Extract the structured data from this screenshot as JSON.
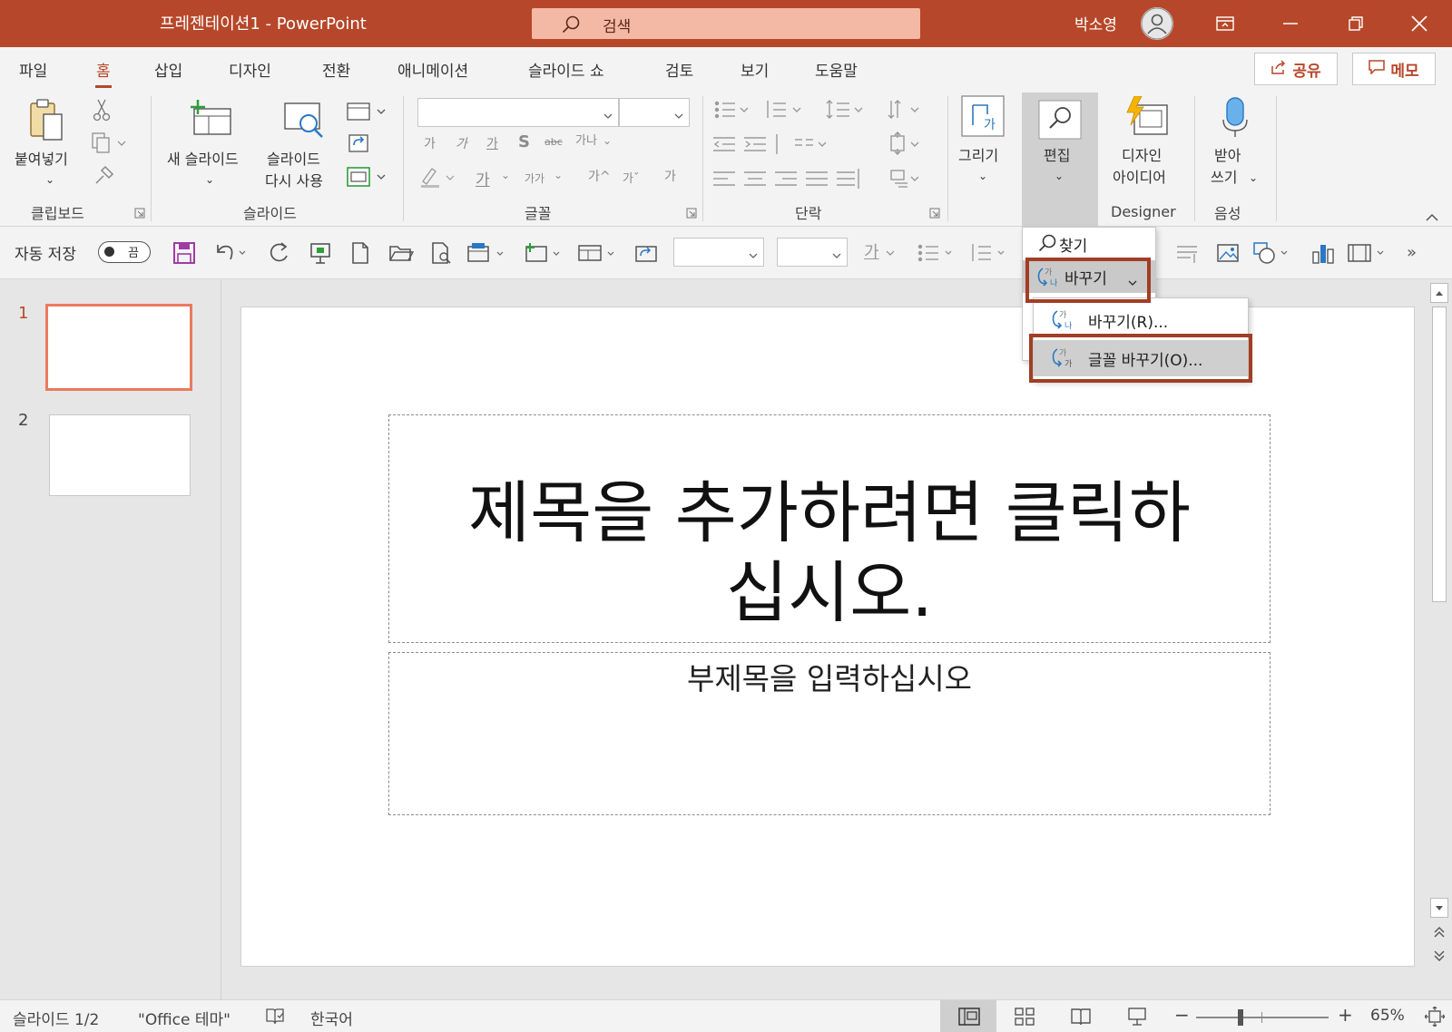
{
  "colors": {
    "accent": "#b7472a",
    "highlight": "#a13e25"
  },
  "titlebar": {
    "doc_title": "프레젠테이션1  -  PowerPoint",
    "search_placeholder": "검색",
    "user_name": "박소영"
  },
  "tabs": [
    "파일",
    "홈",
    "삽입",
    "디자인",
    "전환",
    "애니메이션",
    "슬라이드 쇼",
    "검토",
    "보기",
    "도움말"
  ],
  "active_tab": "홈",
  "share_label": "공유",
  "memo_label": "메모",
  "ribbon": {
    "paste": "붙여넣기",
    "new_slide": "새 슬라이드",
    "reuse_slide_1": "슬라이드",
    "reuse_slide_2": "다시 사용",
    "draw": "그리기",
    "edit": "편집",
    "design_ideas_1": "디자인",
    "design_ideas_2": "아이디어",
    "dictate_1": "받아",
    "dictate_2": "쓰기",
    "groups": {
      "clipboard": "클립보드",
      "slides": "슬라이드",
      "font": "글꼴",
      "paragraph": "단락",
      "designer": "Designer",
      "voice": "음성"
    },
    "font_row": {
      "g1": "가",
      "g2": "가",
      "g3": "가",
      "g4": "S",
      "g5": "가나",
      "g6": "가",
      "g7": "가가",
      "g8": "가^",
      "g9": "가ˇ",
      "g10": "가"
    }
  },
  "qat": {
    "autosave_label": "자동 저장",
    "toggle_state": "끔"
  },
  "edit_menu": {
    "find": "찾기",
    "replace": "바꾸기",
    "sub_icon_text": "가나",
    "submenu": [
      "바꾸기(R)...",
      "글꼴 바꾸기(O)..."
    ]
  },
  "thumbnails": [
    "1",
    "2"
  ],
  "slide": {
    "title_line1": "제목을 추가하려면 클릭하",
    "title_line2": "십시오.",
    "subtitle": "부제목을 입력하십시오"
  },
  "status": {
    "slide_count": "슬라이드 1/2",
    "theme": "\"Office 테마\"",
    "language": "한국어",
    "zoom": "65%"
  }
}
